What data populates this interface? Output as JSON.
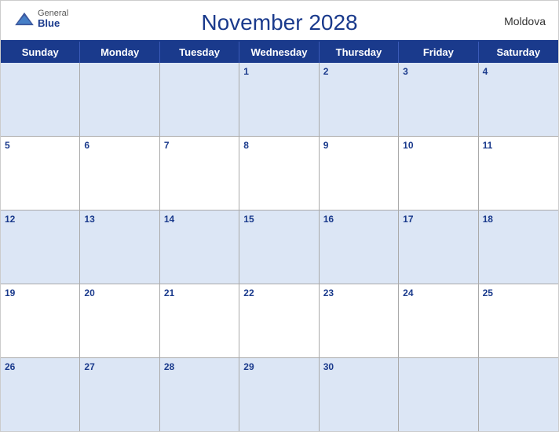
{
  "header": {
    "title": "November 2028",
    "country": "Moldova",
    "logo": {
      "general": "General",
      "blue": "Blue"
    }
  },
  "days_of_week": [
    "Sunday",
    "Monday",
    "Tuesday",
    "Wednesday",
    "Thursday",
    "Friday",
    "Saturday"
  ],
  "weeks": [
    [
      {
        "date": "",
        "empty": true
      },
      {
        "date": "",
        "empty": true
      },
      {
        "date": "",
        "empty": true
      },
      {
        "date": "1",
        "empty": false
      },
      {
        "date": "2",
        "empty": false
      },
      {
        "date": "3",
        "empty": false
      },
      {
        "date": "4",
        "empty": false
      }
    ],
    [
      {
        "date": "5",
        "empty": false
      },
      {
        "date": "6",
        "empty": false
      },
      {
        "date": "7",
        "empty": false
      },
      {
        "date": "8",
        "empty": false
      },
      {
        "date": "9",
        "empty": false
      },
      {
        "date": "10",
        "empty": false
      },
      {
        "date": "11",
        "empty": false
      }
    ],
    [
      {
        "date": "12",
        "empty": false
      },
      {
        "date": "13",
        "empty": false
      },
      {
        "date": "14",
        "empty": false
      },
      {
        "date": "15",
        "empty": false
      },
      {
        "date": "16",
        "empty": false
      },
      {
        "date": "17",
        "empty": false
      },
      {
        "date": "18",
        "empty": false
      }
    ],
    [
      {
        "date": "19",
        "empty": false
      },
      {
        "date": "20",
        "empty": false
      },
      {
        "date": "21",
        "empty": false
      },
      {
        "date": "22",
        "empty": false
      },
      {
        "date": "23",
        "empty": false
      },
      {
        "date": "24",
        "empty": false
      },
      {
        "date": "25",
        "empty": false
      }
    ],
    [
      {
        "date": "26",
        "empty": false
      },
      {
        "date": "27",
        "empty": false
      },
      {
        "date": "28",
        "empty": false
      },
      {
        "date": "29",
        "empty": false
      },
      {
        "date": "30",
        "empty": false
      },
      {
        "date": "",
        "empty": true
      },
      {
        "date": "",
        "empty": true
      }
    ]
  ]
}
